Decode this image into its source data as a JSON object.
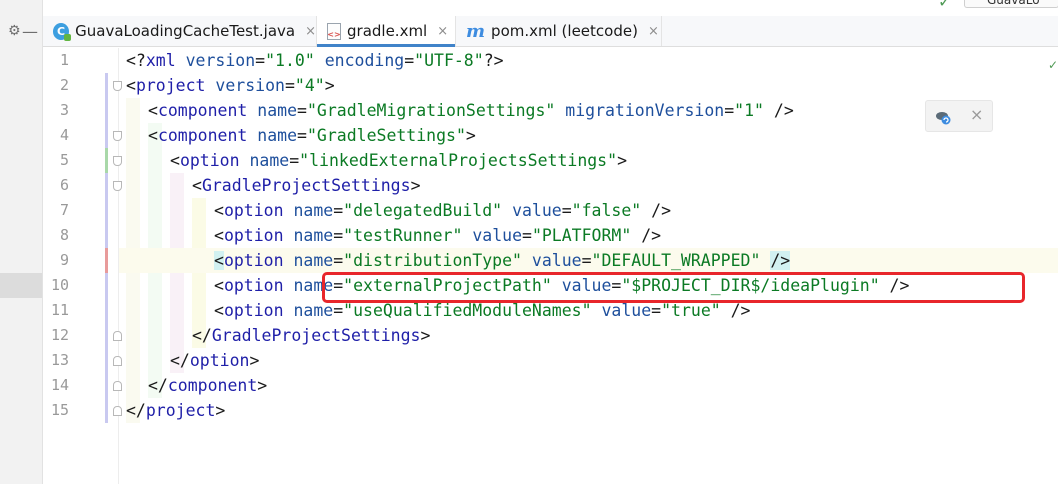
{
  "tabs": [
    {
      "label": "GuavaLoadingCacheTest.java",
      "icon": "java-class-icon",
      "active": false
    },
    {
      "label": "gradle.xml",
      "icon": "xml-file-icon",
      "active": true
    },
    {
      "label": "pom.xml (leetcode)",
      "icon": "maven-icon",
      "active": false
    }
  ],
  "close_glyph": "×",
  "top_right": {
    "file_label": "GuavaLo"
  },
  "lines": [
    {
      "n": "1",
      "indent": 0,
      "parts": [
        [
          "pl",
          "<?"
        ],
        [
          "tg",
          "xml"
        ],
        [
          "pl",
          " "
        ],
        [
          "at",
          "version"
        ],
        [
          "pl",
          "="
        ],
        [
          "vl",
          "\"1.0\""
        ],
        [
          "pl",
          " "
        ],
        [
          "at",
          "encoding"
        ],
        [
          "pl",
          "="
        ],
        [
          "vl",
          "\"UTF-8\""
        ],
        [
          "pl",
          "?>"
        ]
      ]
    },
    {
      "n": "2",
      "indent": 0,
      "parts": [
        [
          "pl",
          "<"
        ],
        [
          "tg",
          "project"
        ],
        [
          "pl",
          " "
        ],
        [
          "at",
          "version"
        ],
        [
          "pl",
          "="
        ],
        [
          "vl",
          "\"4\""
        ],
        [
          "pl",
          ">"
        ]
      ]
    },
    {
      "n": "3",
      "indent": 1,
      "parts": [
        [
          "pl",
          "<"
        ],
        [
          "tg",
          "component"
        ],
        [
          "pl",
          " "
        ],
        [
          "at",
          "name"
        ],
        [
          "pl",
          "="
        ],
        [
          "vl",
          "\"GradleMigrationSettings\""
        ],
        [
          "pl",
          " "
        ],
        [
          "at",
          "migrationVersion"
        ],
        [
          "pl",
          "="
        ],
        [
          "vl",
          "\"1\""
        ],
        [
          "pl",
          " />"
        ]
      ]
    },
    {
      "n": "4",
      "indent": 1,
      "parts": [
        [
          "pl",
          "<"
        ],
        [
          "tg",
          "component"
        ],
        [
          "pl",
          " "
        ],
        [
          "at",
          "name"
        ],
        [
          "pl",
          "="
        ],
        [
          "vl",
          "\"GradleSettings\""
        ],
        [
          "pl",
          ">"
        ]
      ]
    },
    {
      "n": "5",
      "indent": 2,
      "parts": [
        [
          "pl",
          "<"
        ],
        [
          "tg",
          "option"
        ],
        [
          "pl",
          " "
        ],
        [
          "at",
          "name"
        ],
        [
          "pl",
          "="
        ],
        [
          "vl",
          "\"linkedExternalProjectsSettings\""
        ],
        [
          "pl",
          ">"
        ]
      ]
    },
    {
      "n": "6",
      "indent": 3,
      "parts": [
        [
          "pl",
          "<"
        ],
        [
          "tg",
          "GradleProjectSettings"
        ],
        [
          "pl",
          ">"
        ]
      ]
    },
    {
      "n": "7",
      "indent": 4,
      "parts": [
        [
          "pl",
          "<"
        ],
        [
          "tg",
          "option"
        ],
        [
          "pl",
          " "
        ],
        [
          "at",
          "name"
        ],
        [
          "pl",
          "="
        ],
        [
          "vl",
          "\"delegatedBuild\""
        ],
        [
          "pl",
          " "
        ],
        [
          "at",
          "value"
        ],
        [
          "pl",
          "="
        ],
        [
          "vl",
          "\"false\""
        ],
        [
          "pl",
          " />"
        ]
      ]
    },
    {
      "n": "8",
      "indent": 4,
      "parts": [
        [
          "pl",
          "<"
        ],
        [
          "tg",
          "option"
        ],
        [
          "pl",
          " "
        ],
        [
          "at",
          "name"
        ],
        [
          "pl",
          "="
        ],
        [
          "vl",
          "\"testRunner\""
        ],
        [
          "pl",
          " "
        ],
        [
          "at",
          "value"
        ],
        [
          "pl",
          "="
        ],
        [
          "vl",
          "\"PLATFORM\""
        ],
        [
          "pl",
          " />"
        ]
      ]
    },
    {
      "n": "9",
      "indent": 4,
      "parts": [
        [
          "pl",
          "<"
        ],
        [
          "tg",
          "option"
        ],
        [
          "pl",
          " "
        ],
        [
          "at",
          "name"
        ],
        [
          "pl",
          "="
        ],
        [
          "vl",
          "\"distributionType\""
        ],
        [
          "pl",
          " "
        ],
        [
          "at",
          "value"
        ],
        [
          "pl",
          "="
        ],
        [
          "vl",
          "\"DEFAULT_WRAPPED\""
        ],
        [
          "pl",
          " "
        ],
        [
          "pl",
          "/>"
        ]
      ]
    },
    {
      "n": "10",
      "indent": 4,
      "parts": [
        [
          "pl",
          "<"
        ],
        [
          "tg",
          "option"
        ],
        [
          "pl",
          " "
        ],
        [
          "at",
          "name"
        ],
        [
          "pl",
          "="
        ],
        [
          "vl",
          "\"externalProjectPath\""
        ],
        [
          "pl",
          " "
        ],
        [
          "at",
          "value"
        ],
        [
          "pl",
          "="
        ],
        [
          "vl",
          "\"$PROJECT_DIR$/ideaPlugin\""
        ],
        [
          "pl",
          " />"
        ]
      ]
    },
    {
      "n": "11",
      "indent": 4,
      "parts": [
        [
          "pl",
          "<"
        ],
        [
          "tg",
          "option"
        ],
        [
          "pl",
          " "
        ],
        [
          "at",
          "name"
        ],
        [
          "pl",
          "="
        ],
        [
          "vl",
          "\"useQualifiedModuleNames\""
        ],
        [
          "pl",
          " "
        ],
        [
          "at",
          "value"
        ],
        [
          "pl",
          "="
        ],
        [
          "vl",
          "\"true\""
        ],
        [
          "pl",
          " />"
        ]
      ]
    },
    {
      "n": "12",
      "indent": 3,
      "parts": [
        [
          "pl",
          "</"
        ],
        [
          "tg",
          "GradleProjectSettings"
        ],
        [
          "pl",
          ">"
        ]
      ]
    },
    {
      "n": "13",
      "indent": 2,
      "parts": [
        [
          "pl",
          "</"
        ],
        [
          "tg",
          "option"
        ],
        [
          "pl",
          ">"
        ]
      ]
    },
    {
      "n": "14",
      "indent": 1,
      "parts": [
        [
          "pl",
          "</"
        ],
        [
          "tg",
          "component"
        ],
        [
          "pl",
          ">"
        ]
      ]
    },
    {
      "n": "15",
      "indent": 0,
      "parts": [
        [
          "pl",
          "</"
        ],
        [
          "tg",
          "project"
        ],
        [
          "pl",
          ">"
        ]
      ]
    }
  ],
  "colors": {
    "tag": "#1f1fa8",
    "attr": "#1e4f9c",
    "value": "#0b7a24",
    "highlight_box": "#e8262b",
    "caret_line": "#fcfbed"
  }
}
